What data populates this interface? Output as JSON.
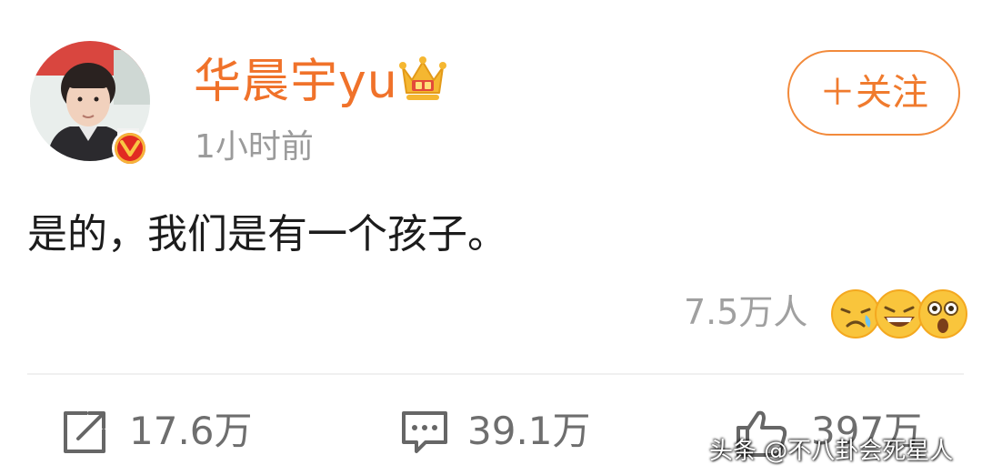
{
  "post": {
    "username": "华晨宇yu",
    "timestamp": "1小时前",
    "follow_label": "＋关注",
    "text": "是的，我们是有一个孩子。",
    "reaction_count": "7.5万人",
    "reaction_icons": [
      "crying-laugh-emoji-icon",
      "grinning-emoji-icon",
      "surprised-emoji-icon"
    ]
  },
  "actions": {
    "share_count": "17.6万",
    "comment_count": "39.1万",
    "like_count": "397万"
  },
  "watermark": "头条 @不八卦会死星人",
  "colors": {
    "accent": "#f07b2e",
    "username": "#f0722a",
    "muted": "#9b9b9b",
    "text": "#1c1c1c",
    "verified_red": "#e12a22",
    "crown_gold": "#f5b731"
  }
}
